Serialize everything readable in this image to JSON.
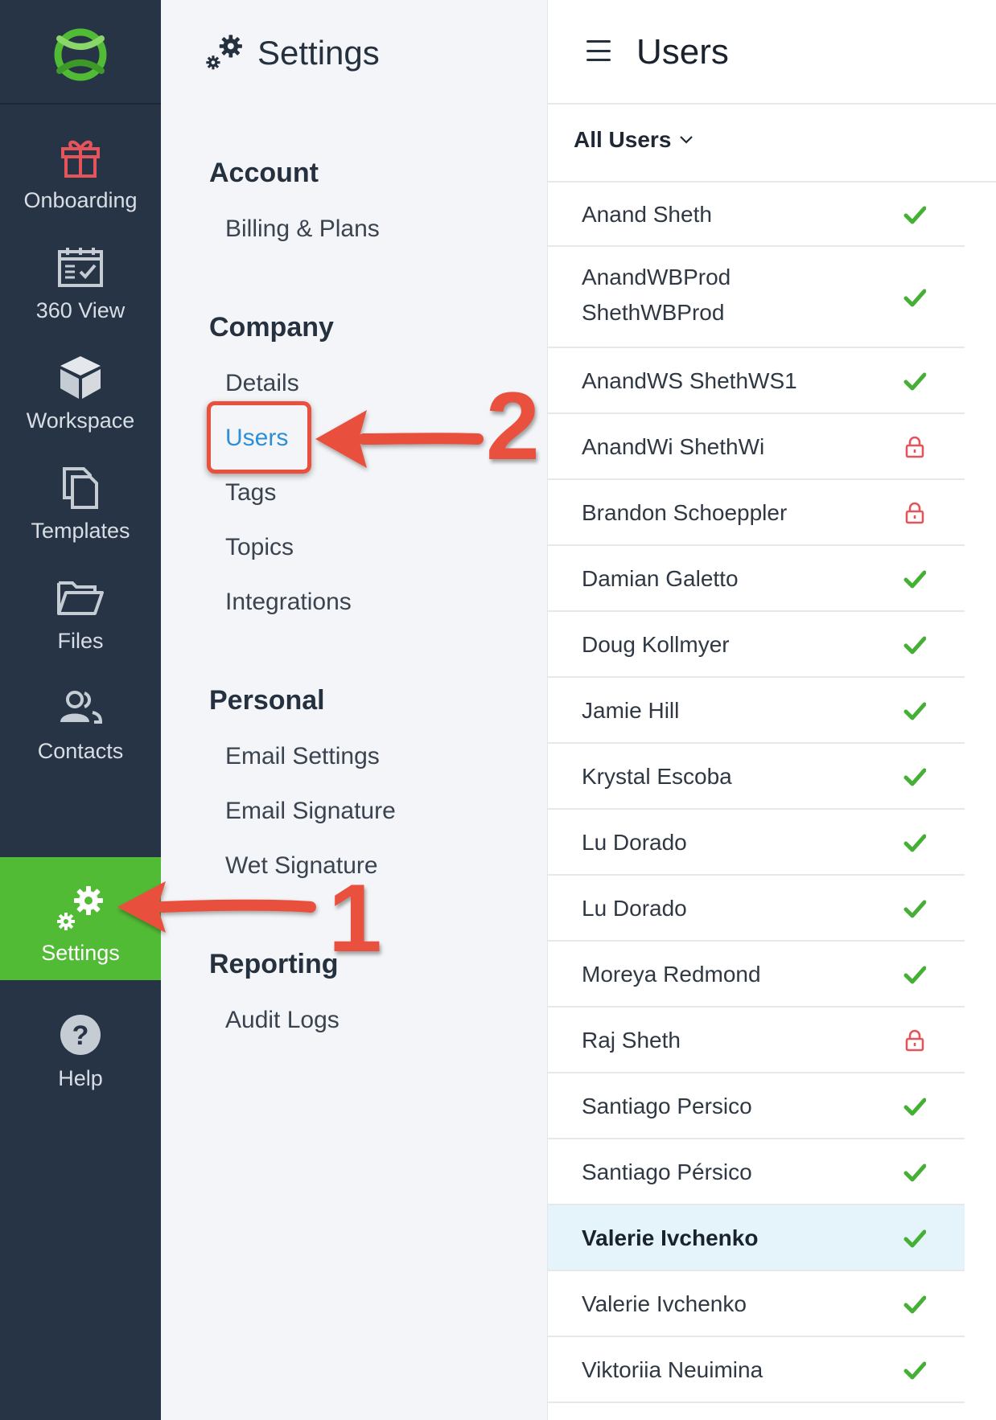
{
  "nav": {
    "items": [
      {
        "label": "Onboarding",
        "icon": "gift-icon"
      },
      {
        "label": "360 View",
        "icon": "calendar-check-icon"
      },
      {
        "label": "Workspace",
        "icon": "cube-icon"
      },
      {
        "label": "Templates",
        "icon": "copy-icon"
      },
      {
        "label": "Files",
        "icon": "folder-icon"
      },
      {
        "label": "Contacts",
        "icon": "users-icon"
      },
      {
        "label": "Settings",
        "icon": "gears-icon",
        "active": true
      },
      {
        "label": "Help",
        "icon": "help-icon"
      }
    ]
  },
  "settings": {
    "title": "Settings",
    "sections": [
      {
        "heading": "Account",
        "links": [
          "Billing & Plans"
        ]
      },
      {
        "heading": "Company",
        "links": [
          "Details",
          "Users",
          "Tags",
          "Topics",
          "Integrations"
        ]
      },
      {
        "heading": "Personal",
        "links": [
          "Email Settings",
          "Email Signature",
          "Wet Signature"
        ]
      },
      {
        "heading": "Reporting",
        "links": [
          "Audit Logs"
        ]
      }
    ],
    "selected_link": "Users"
  },
  "users": {
    "title": "Users",
    "filter_label": "All Users",
    "rows": [
      {
        "name": "Anand Sheth",
        "status": "active"
      },
      {
        "name": "AnandWBProd ShethWBProd",
        "status": "active"
      },
      {
        "name": "AnandWS ShethWS1",
        "status": "active"
      },
      {
        "name": "AnandWi ShethWi",
        "status": "locked"
      },
      {
        "name": "Brandon Schoeppler",
        "status": "locked"
      },
      {
        "name": "Damian Galetto",
        "status": "active"
      },
      {
        "name": "Doug Kollmyer",
        "status": "active"
      },
      {
        "name": "Jamie Hill",
        "status": "active"
      },
      {
        "name": "Krystal Escoba",
        "status": "active"
      },
      {
        "name": "Lu Dorado",
        "status": "active"
      },
      {
        "name": "Lu Dorado",
        "status": "active"
      },
      {
        "name": "Moreya Redmond",
        "status": "active"
      },
      {
        "name": "Raj Sheth",
        "status": "locked"
      },
      {
        "name": "Santiago Persico",
        "status": "active"
      },
      {
        "name": "Santiago Pérsico",
        "status": "active"
      },
      {
        "name": "Valerie Ivchenko",
        "status": "active",
        "highlighted": true
      },
      {
        "name": "Valerie Ivchenko",
        "status": "active"
      },
      {
        "name": "Viktoriia Neuimina",
        "status": "active"
      }
    ]
  },
  "annotations": {
    "step1": "1",
    "step2": "2"
  },
  "colors": {
    "nav_bg": "#263445",
    "active_green": "#52bb35",
    "check_green": "#45b035",
    "lock_red": "#e5535b",
    "link_blue": "#2d8fd5",
    "annotation_red": "#e9503d",
    "highlight_row": "#e5f3fb"
  }
}
